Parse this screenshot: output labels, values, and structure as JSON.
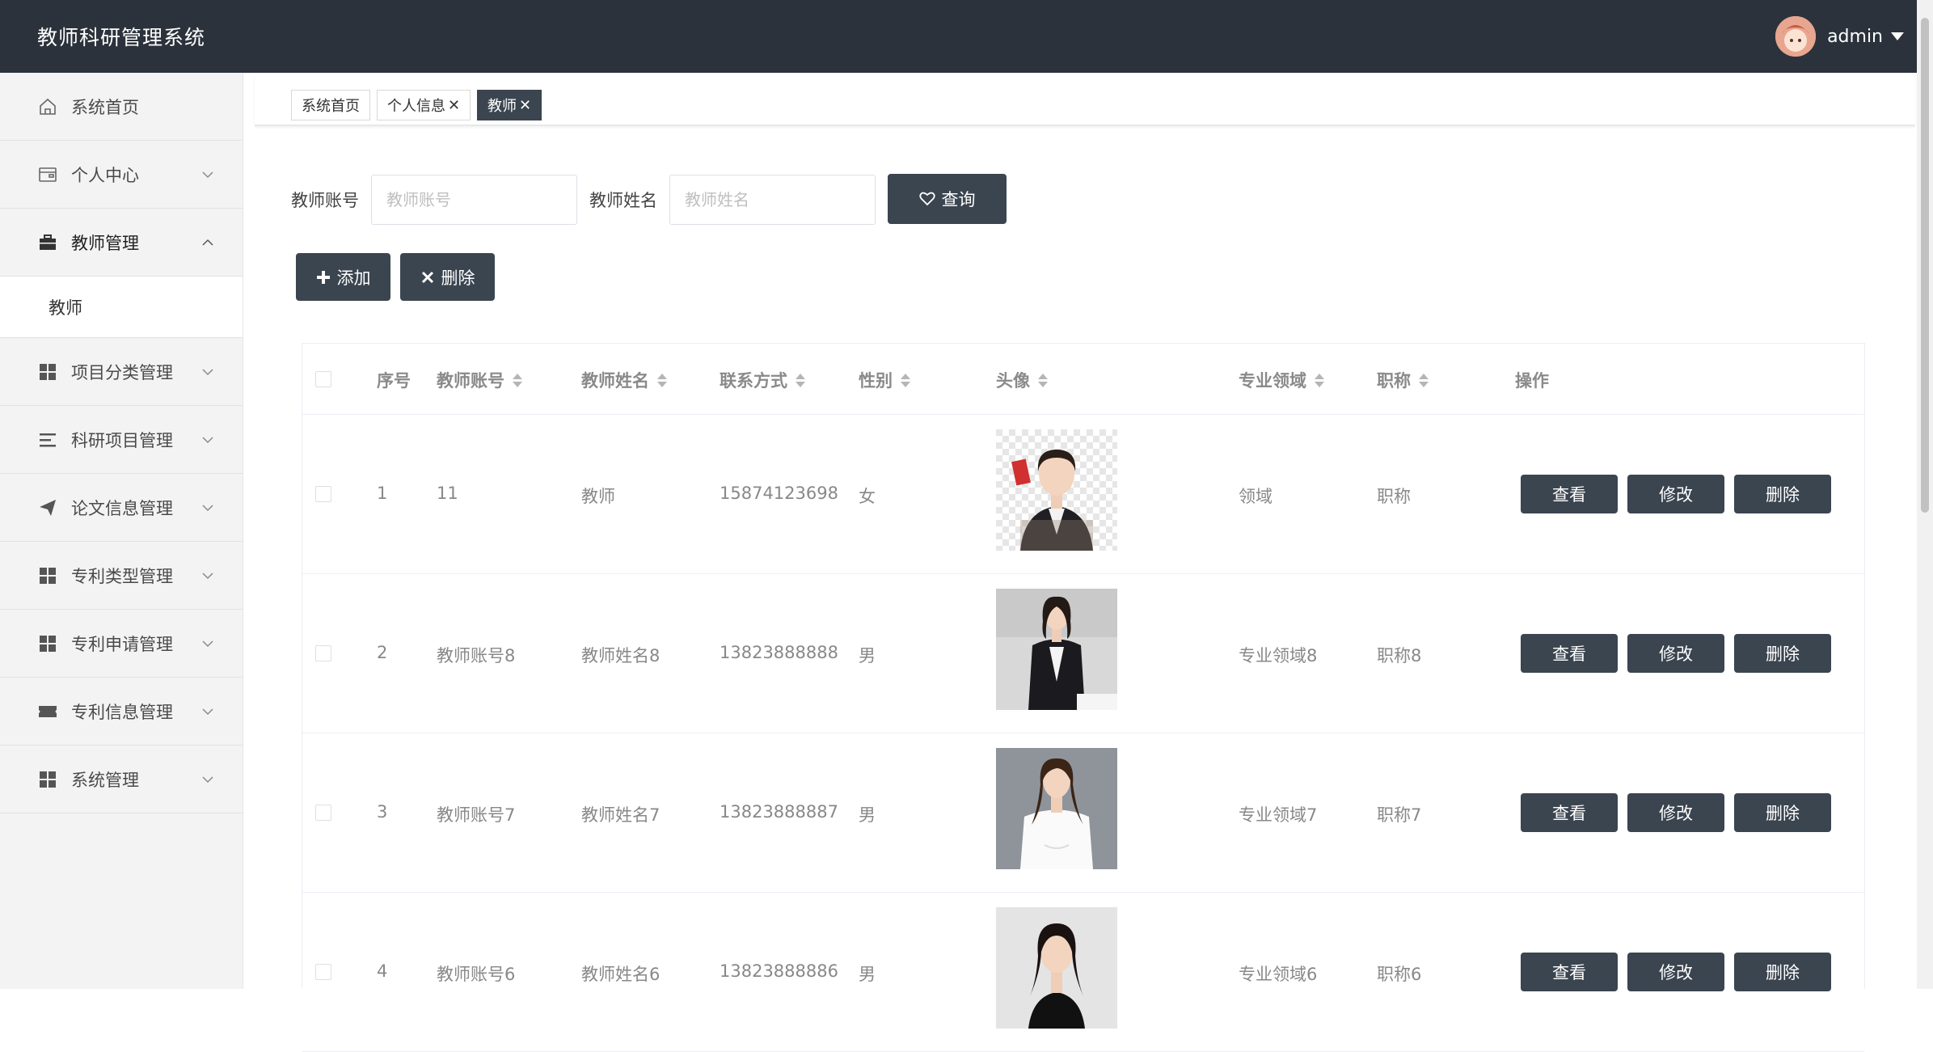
{
  "app": {
    "title": "教师科研管理系统",
    "user": "admin"
  },
  "sidebar": {
    "items": [
      {
        "label": "系统首页",
        "icon": "home-icon"
      },
      {
        "label": "个人中心",
        "icon": "wallet-icon"
      },
      {
        "label": "教师管理",
        "icon": "briefcase-icon",
        "expanded": true,
        "sub": [
          "教师"
        ]
      },
      {
        "label": "项目分类管理",
        "icon": "grid-icon"
      },
      {
        "label": "科研项目管理",
        "icon": "list-icon"
      },
      {
        "label": "论文信息管理",
        "icon": "paper-plane-icon"
      },
      {
        "label": "专利类型管理",
        "icon": "grid-icon"
      },
      {
        "label": "专利申请管理",
        "icon": "grid-icon"
      },
      {
        "label": "专利信息管理",
        "icon": "ticket-icon"
      },
      {
        "label": "系统管理",
        "icon": "grid-icon"
      }
    ]
  },
  "tabs": [
    {
      "label": "系统首页",
      "closable": false
    },
    {
      "label": "个人信息",
      "closable": true
    },
    {
      "label": "教师",
      "closable": true,
      "active": true
    }
  ],
  "tab_close": "✕",
  "search": {
    "account_label": "教师账号",
    "account_placeholder": "教师账号",
    "name_label": "教师姓名",
    "name_placeholder": "教师姓名",
    "query_button": "查询"
  },
  "toolbar": {
    "add": "添加",
    "delete": "删除"
  },
  "table": {
    "headers": [
      "序号",
      "教师账号",
      "教师姓名",
      "联系方式",
      "性别",
      "头像",
      "专业领域",
      "职称",
      "操作"
    ],
    "rows": [
      {
        "index": "1",
        "account": "11",
        "name": "教师",
        "phone": "15874123698",
        "gender": "女",
        "field": "领域",
        "title": "职称"
      },
      {
        "index": "2",
        "account": "教师账号8",
        "name": "教师姓名8",
        "phone": "13823888888",
        "gender": "男",
        "field": "专业领域8",
        "title": "职称8"
      },
      {
        "index": "3",
        "account": "教师账号7",
        "name": "教师姓名7",
        "phone": "13823888887",
        "gender": "男",
        "field": "专业领域7",
        "title": "职称7"
      },
      {
        "index": "4",
        "account": "教师账号6",
        "name": "教师姓名6",
        "phone": "13823888886",
        "gender": "男",
        "field": "专业领域6",
        "title": "职称6"
      }
    ],
    "actions": {
      "view": "查看",
      "edit": "修改",
      "delete": "删除"
    }
  },
  "colors": {
    "header_bg": "#2b323b",
    "button_bg": "#3b4550",
    "sidebar_bg": "#f3f3f3"
  }
}
